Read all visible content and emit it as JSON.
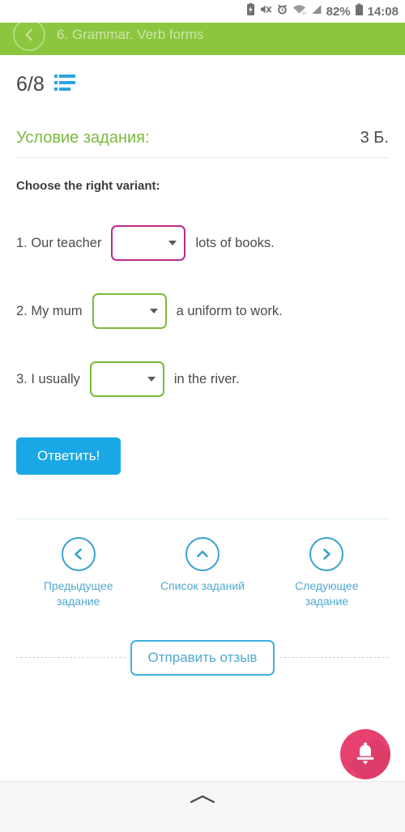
{
  "statusbar": {
    "battery_percent": "82%",
    "time": "14:08",
    "icons": [
      "battery-saver-icon",
      "volume-mute-icon",
      "alarm-clock-icon",
      "wifi-icon",
      "cellular-signal-icon",
      "battery-icon"
    ]
  },
  "header": {
    "back_icon": "back-arrow-icon",
    "title": "6. Grammar. Verb forms",
    "bg_color": "#8cc63e"
  },
  "progress": {
    "fraction": "6/8",
    "list_icon": "task-list-icon",
    "list_icon_color": "#2ea3e0"
  },
  "condition": {
    "label": "Условие задания:",
    "points": "3 Б.",
    "label_color": "#7aba3c"
  },
  "task": {
    "prompt": "Choose the right variant:",
    "questions": [
      {
        "pre": "1. Our teacher",
        "post": "lots of books.",
        "dropdown_value": "",
        "dropdown_border_color": "#bd2a8c",
        "state": "incorrect"
      },
      {
        "pre": "2. My mum",
        "post": "a uniform to work.",
        "dropdown_value": "",
        "dropdown_border_color": "#7aba3c",
        "state": "neutral"
      },
      {
        "pre": "3. I usually",
        "post": "in the river.",
        "dropdown_value": "",
        "dropdown_border_color": "#7aba3c",
        "state": "neutral"
      }
    ],
    "submit_label": "Ответить!",
    "submit_color": "#19a8e5"
  },
  "nav": {
    "items": [
      {
        "label": "Предыдущее задание",
        "icon": "chevron-left-icon"
      },
      {
        "label": "Список заданий",
        "icon": "chevron-up-icon"
      },
      {
        "label": "Следующее задание",
        "icon": "chevron-right-icon"
      }
    ],
    "accent_color": "#4fa9cf"
  },
  "feedback": {
    "button_label": "Отправить отзыв",
    "button_color": "#3fb3de"
  },
  "fab": {
    "icon": "bell-icon",
    "color": "#e8416f"
  },
  "androidnav": {
    "icon": "chevron-up-icon"
  }
}
